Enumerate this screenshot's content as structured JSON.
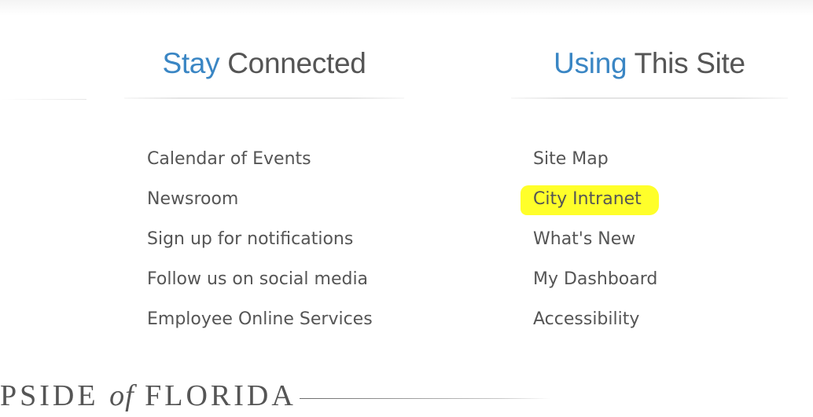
{
  "stay_connected": {
    "heading_accent": "Stay",
    "heading_rest": "Connected",
    "links": [
      "Calendar of Events",
      "Newsroom",
      "Sign up for notifications",
      "Follow us on social media",
      "Employee Online Services"
    ]
  },
  "using_this_site": {
    "heading_accent": "Using",
    "heading_rest": "This Site",
    "links": [
      "Site Map",
      "City Intranet",
      "What's New",
      "My Dashboard",
      "Accessibility"
    ],
    "highlighted_link": "City Intranet"
  },
  "footer": {
    "brand_start": "PSIDE",
    "brand_of": "of",
    "brand_end": "FLORIDA"
  },
  "colors": {
    "accent": "#3a86c4",
    "text": "#555555",
    "highlight": "#ffff2a"
  }
}
